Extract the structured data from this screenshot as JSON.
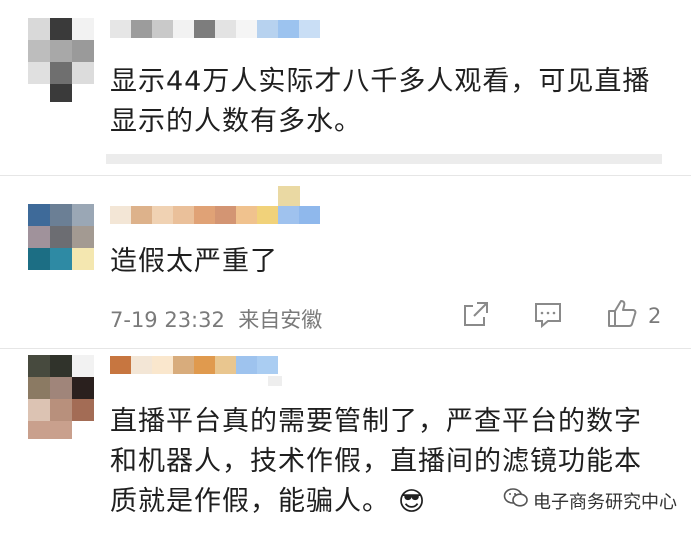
{
  "comments": [
    {
      "text_lines": [
        "显示44万人实际才八千多人观看，可见直播",
        "显示的人数有多水。"
      ]
    },
    {
      "text_lines": [
        "造假太严重了"
      ],
      "time": "7-19 23:32",
      "location": "来自安徽",
      "like_count": "2"
    },
    {
      "text_lines": [
        "直播平台真的需要管制了，严查平台的数字",
        "和机器人，技术作假，直播间的滤镜功能本",
        "质就是作假，能骗人。"
      ],
      "emoji": "😎"
    }
  ],
  "watermark": {
    "text": "电子商务研究中心"
  },
  "icons": [
    "share-icon",
    "comment-icon",
    "like-icon",
    "wechat-icon"
  ]
}
